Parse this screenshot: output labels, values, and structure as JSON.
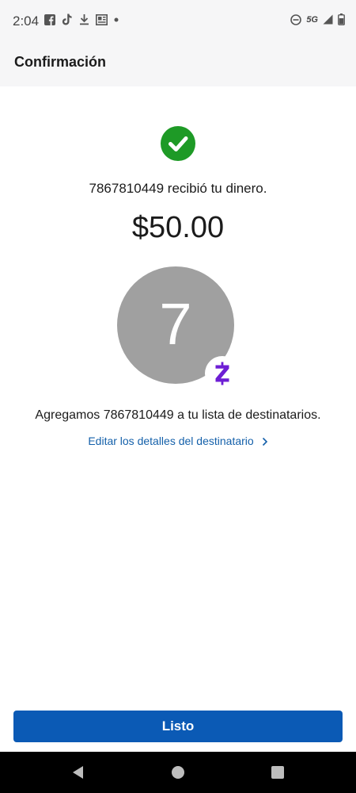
{
  "status_bar": {
    "time": "2:04",
    "left_icons": [
      "facebook-icon",
      "tiktok-icon",
      "download-icon",
      "news-icon",
      "dot-icon"
    ],
    "network": "5G",
    "right_icons": [
      "do-not-disturb-icon",
      "signal-icon",
      "battery-icon"
    ]
  },
  "header": {
    "title": "Confirmación"
  },
  "confirmation": {
    "success_icon": "check-icon",
    "success_color": "#1e9a26",
    "message": "7867810449 recibió tu dinero.",
    "amount": "$50.00",
    "avatar_initial": "7",
    "avatar_color": "#a0a0a0",
    "badge_icon": "zelle-icon",
    "badge_color": "#6d1ed4",
    "recipient_added": "Agregamos 7867810449 a tu lista de destinatarios.",
    "edit_link": "Editar los detalles del destinatario"
  },
  "footer": {
    "done_label": "Listo",
    "button_color": "#0b5ab5"
  },
  "nav_bar": {
    "icons": [
      "back-icon",
      "home-icon",
      "recents-icon"
    ]
  }
}
